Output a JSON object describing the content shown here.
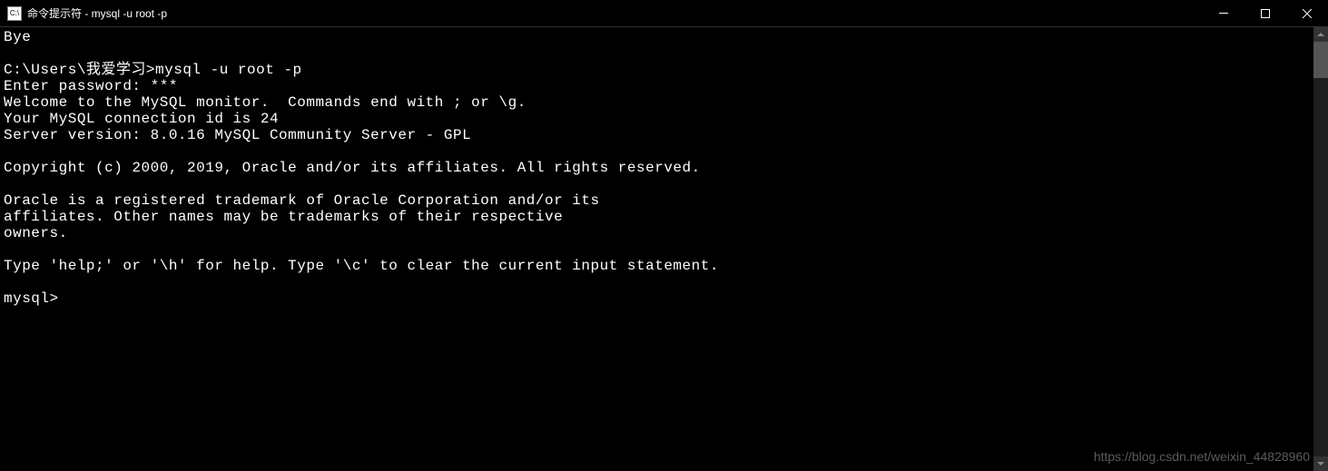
{
  "titlebar": {
    "icon_text": "C:\\",
    "title": "命令提示符 - mysql  -u root -p"
  },
  "terminal": {
    "lines": [
      "Bye",
      "",
      "C:\\Users\\我爱学习>mysql -u root -p",
      "Enter password: ***",
      "Welcome to the MySQL monitor.  Commands end with ; or \\g.",
      "Your MySQL connection id is 24",
      "Server version: 8.0.16 MySQL Community Server - GPL",
      "",
      "Copyright (c) 2000, 2019, Oracle and/or its affiliates. All rights reserved.",
      "",
      "Oracle is a registered trademark of Oracle Corporation and/or its",
      "affiliates. Other names may be trademarks of their respective",
      "owners.",
      "",
      "Type 'help;' or '\\h' for help. Type '\\c' to clear the current input statement.",
      "",
      "mysql>"
    ]
  },
  "watermark": "https://blog.csdn.net/weixin_44828960"
}
